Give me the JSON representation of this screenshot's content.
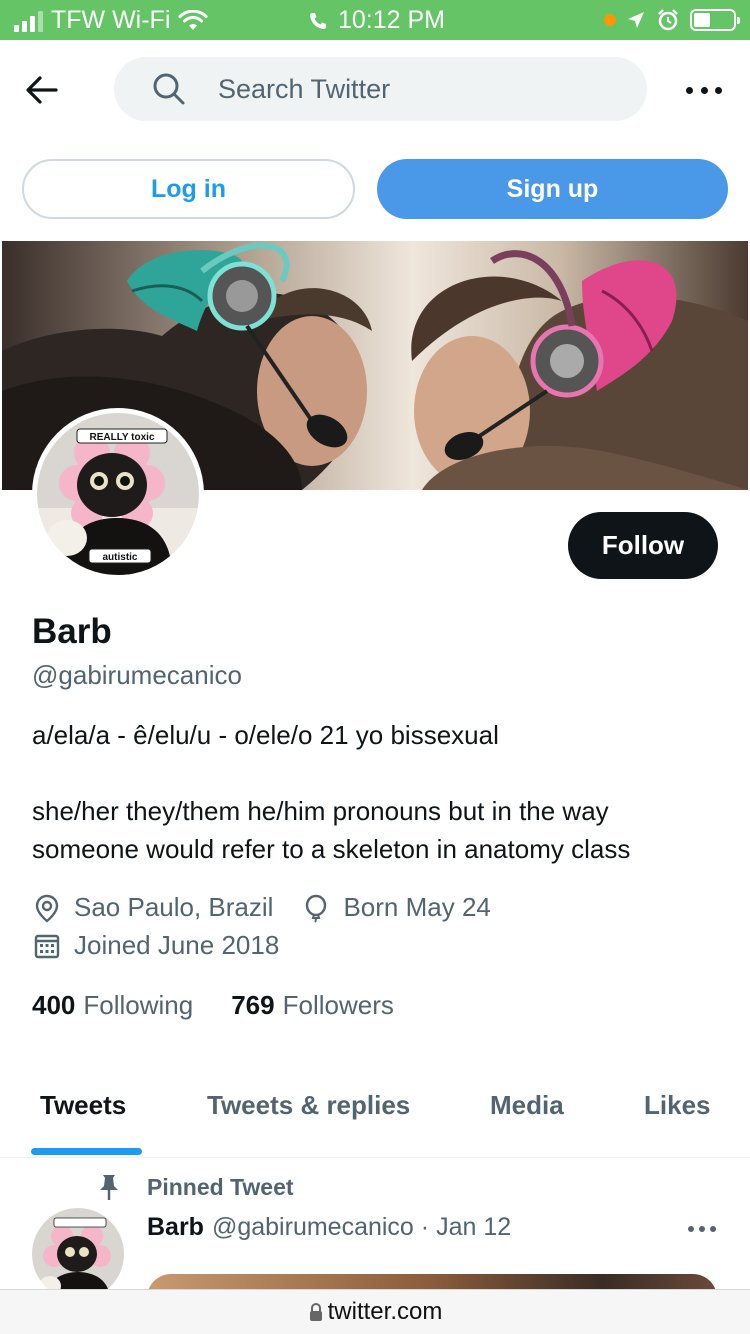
{
  "status_bar": {
    "carrier": "TFW Wi-Fi",
    "time": "10:12 PM",
    "icons": [
      "signal-icon",
      "wifi-icon",
      "phone-icon",
      "location-icon",
      "alarm-icon",
      "battery-icon"
    ]
  },
  "header": {
    "search_placeholder": "Search Twitter"
  },
  "auth": {
    "login_label": "Log in",
    "signup_label": "Sign up"
  },
  "profile": {
    "avatar_top_caption": "REALLY toxic",
    "avatar_bottom_caption": "autistic",
    "follow_label": "Follow",
    "name": "Barb",
    "handle": "@gabirumecanico",
    "bio_line1": "a/ela/a - ê/elu/u - o/ele/o 21 yo bissexual",
    "bio_line2": "she/her they/them he/him pronouns but in the way someone would refer to a skeleton in anatomy class",
    "location": "Sao Paulo, Brazil",
    "birthday": "Born May 24",
    "joined": "Joined June 2018",
    "following_count": "400",
    "following_label": "Following",
    "followers_count": "769",
    "followers_label": "Followers"
  },
  "tabs": [
    "Tweets",
    "Tweets & replies",
    "Media",
    "Likes"
  ],
  "active_tab": "Tweets",
  "pinned_tweet": {
    "pinned_label": "Pinned Tweet",
    "name": "Barb",
    "handle": "@gabirumecanico",
    "separator": "·",
    "date": "Jan 12"
  },
  "browser": {
    "url": "twitter.com"
  },
  "colors": {
    "status_bar_bg": "#65c466",
    "accent_blue": "#1d9bf0",
    "signup_blue": "#4a99e9",
    "text_primary": "#0f1419",
    "text_secondary": "#536471"
  }
}
